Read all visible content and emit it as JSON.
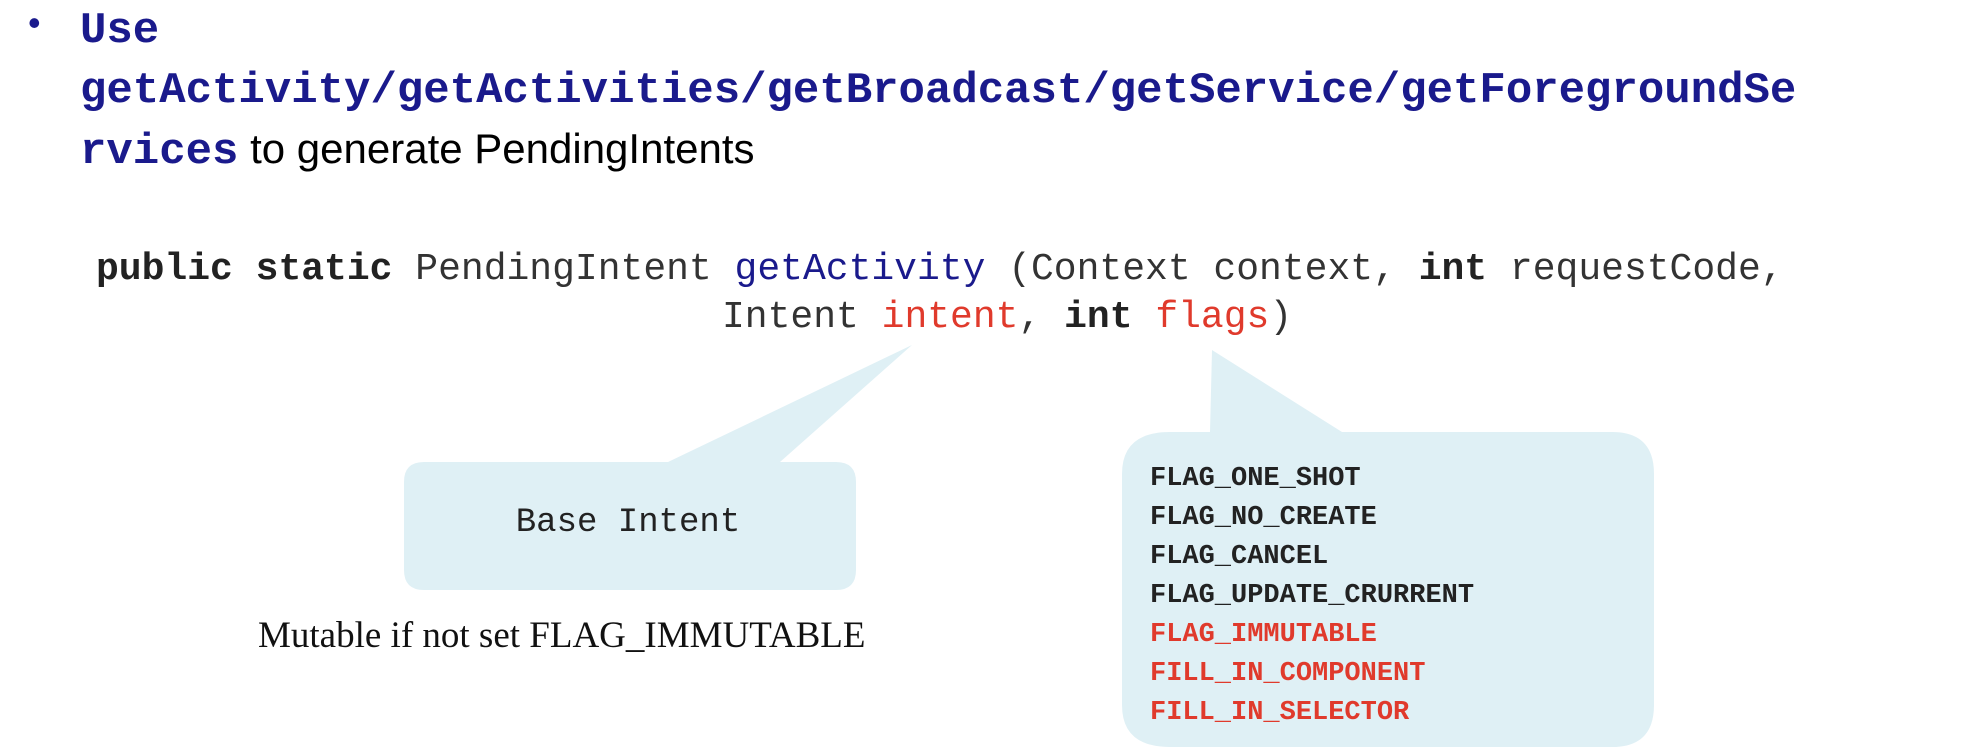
{
  "bullet": {
    "use_word": "Use",
    "methods_line1": "getActivity/getActivities/getBroadcast/getService/getForegroundSe",
    "methods_line2": "rvices",
    "suffix": " to generate PendingIntents"
  },
  "signature": {
    "kw_public": "public",
    "kw_static": "static",
    "return_type": "PendingIntent",
    "method": "getActivity",
    "params_a": "(Context context,",
    "kw_int_1": "int",
    "param_request": "requestCode,",
    "type_intent": "Intent",
    "param_intent": "intent",
    "comma": ",",
    "kw_int_2": "int",
    "param_flags": "flags",
    "close_paren": ")"
  },
  "base_intent_callout": {
    "label": "Base Intent",
    "note": "Mutable if not set FLAG_IMMUTABLE"
  },
  "flags_callout": {
    "flags": [
      {
        "name": "FLAG_ONE_SHOT",
        "highlight": false
      },
      {
        "name": "FLAG_NO_CREATE",
        "highlight": false
      },
      {
        "name": "FLAG_CANCEL",
        "highlight": false
      },
      {
        "name": "FLAG_UPDATE_CRURRENT",
        "highlight": false
      },
      {
        "name": "FLAG_IMMUTABLE",
        "highlight": true
      },
      {
        "name": "FILL_IN_COMPONENT",
        "highlight": true
      },
      {
        "name": "FILL_IN_SELECTOR",
        "highlight": true
      }
    ]
  },
  "colors": {
    "navy": "#1a1a8c",
    "highlight_red": "#e03a2c",
    "callout_fill": "#dff0f5"
  }
}
